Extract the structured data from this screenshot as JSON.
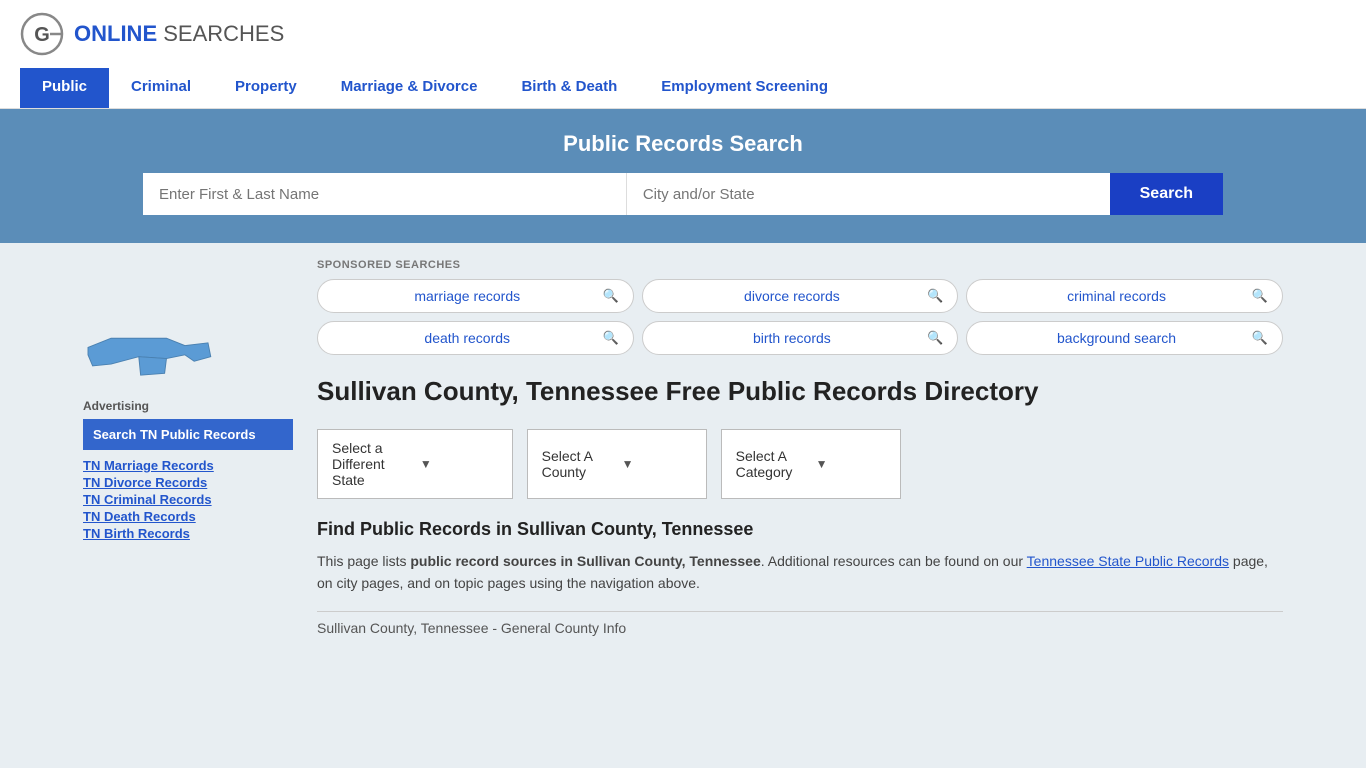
{
  "site": {
    "logo_icon_text": "G",
    "logo_name": "ONLINE SEARCHES"
  },
  "nav": {
    "items": [
      {
        "id": "public",
        "label": "Public",
        "active": true
      },
      {
        "id": "criminal",
        "label": "Criminal",
        "active": false
      },
      {
        "id": "property",
        "label": "Property",
        "active": false
      },
      {
        "id": "marriage-divorce",
        "label": "Marriage & Divorce",
        "active": false
      },
      {
        "id": "birth-death",
        "label": "Birth & Death",
        "active": false
      },
      {
        "id": "employment",
        "label": "Employment Screening",
        "active": false
      }
    ]
  },
  "search_banner": {
    "title": "Public Records Search",
    "name_placeholder": "Enter First & Last Name",
    "location_placeholder": "City and/or State",
    "button_label": "Search"
  },
  "sponsored": {
    "label": "SPONSORED SEARCHES",
    "tags": [
      {
        "text": "marriage records"
      },
      {
        "text": "divorce records"
      },
      {
        "text": "criminal records"
      },
      {
        "text": "death records"
      },
      {
        "text": "birth records"
      },
      {
        "text": "background search"
      }
    ]
  },
  "directory": {
    "heading": "Sullivan County, Tennessee Free Public Records Directory",
    "dropdowns": [
      {
        "id": "state",
        "label": "Select a Different State"
      },
      {
        "id": "county",
        "label": "Select A County"
      },
      {
        "id": "category",
        "label": "Select A Category"
      }
    ],
    "find_heading": "Find Public Records in Sullivan County, Tennessee",
    "find_text_part1": "This page lists ",
    "find_text_bold": "public record sources in Sullivan County, Tennessee",
    "find_text_part2": ". Additional resources can be found on our ",
    "find_link": "Tennessee State Public Records",
    "find_text_part3": " page, on city pages, and on topic pages using the navigation above.",
    "general_info_label": "Sullivan County, Tennessee - General County Info"
  },
  "sidebar": {
    "advertising_label": "Advertising",
    "ad_active_label": "Search TN Public Records",
    "links": [
      {
        "label": "TN Marriage Records"
      },
      {
        "label": "TN Divorce Records"
      },
      {
        "label": "TN Criminal Records"
      },
      {
        "label": "TN Death Records"
      },
      {
        "label": "TN Birth Records"
      }
    ]
  }
}
